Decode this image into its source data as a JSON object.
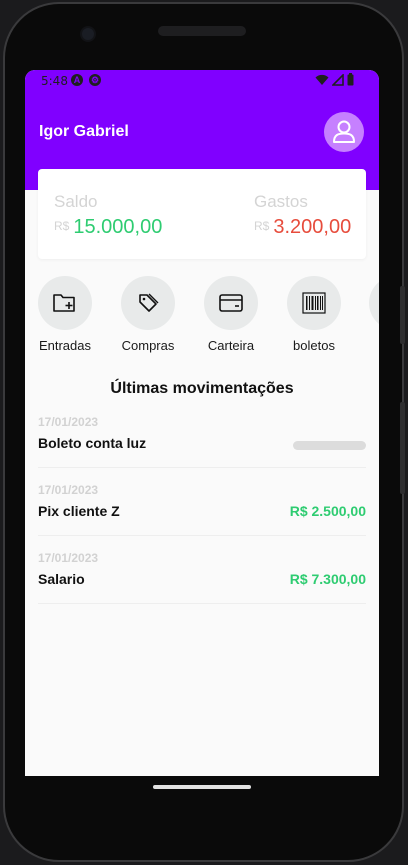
{
  "status_bar": {
    "time": "5:48"
  },
  "header": {
    "user_name": "Igor Gabriel",
    "brand_color": "#8000ff",
    "avatar_icon": "user-icon"
  },
  "balance": {
    "saldo": {
      "label": "Saldo",
      "currency": "R$",
      "value": "15.000,00",
      "color": "#2ecc71"
    },
    "gastos": {
      "label": "Gastos",
      "currency": "R$",
      "value": "3.200,00",
      "color": "#e74c3c"
    }
  },
  "actions": [
    {
      "label": "Entradas",
      "icon": "folder-plus-icon"
    },
    {
      "label": "Compras",
      "icon": "tag-icon"
    },
    {
      "label": "Carteira",
      "icon": "credit-card-icon"
    },
    {
      "label": "boletos",
      "icon": "barcode-icon"
    }
  ],
  "movements": {
    "title": "Últimas movimentações",
    "items": [
      {
        "date": "17/01/2023",
        "description": "Boleto conta luz",
        "value": ""
      },
      {
        "date": "17/01/2023",
        "description": "Pix cliente Z",
        "value": "R$ 2.500,00"
      },
      {
        "date": "17/01/2023",
        "description": "Salario",
        "value": "R$ 7.300,00"
      }
    ]
  }
}
